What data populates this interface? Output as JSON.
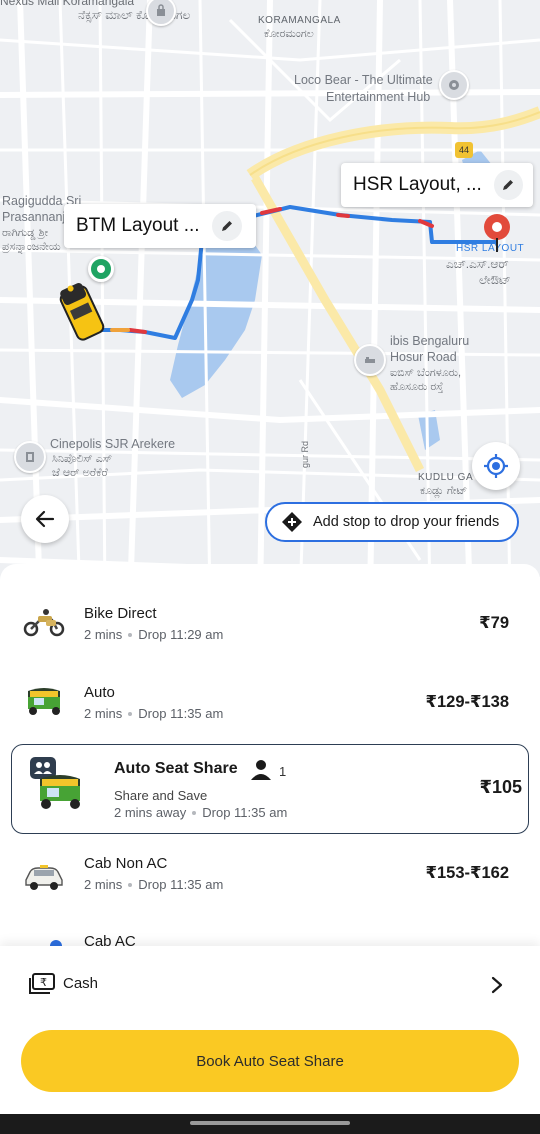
{
  "map": {
    "labels": {
      "nexus_mall": "Nexus Mall Koramangala",
      "nexus_mall_kn": "ನೆಕ್ಸಸ್ ಮಾಲ್ ಕೋರಮಂಗಲ",
      "koramangala": "KORAMANGALA",
      "koramangala_kn": "ಕೋರಮಂಗಲ",
      "loco_bear_1": "Loco Bear - The Ultimate",
      "loco_bear_2": "Entertainment Hub",
      "ragigudda_1": "Ragigudda Sri",
      "ragigudda_2": "Prasannanj",
      "ragigudda_3": "ರಾಗಿಗುಡ್ಡ ಶ್ರೀ",
      "ragigudda_4": "ಪ್ರಸನ್ನಾಂಜನೇಯ",
      "hsr_label": "HSR LAYOUT",
      "hsr_label_kn_1": "ಎಚ್.ಎಸ್.ಆರ್",
      "hsr_label_kn_2": "ಲೇಔಟ್",
      "ibis_1": "ibis Bengaluru",
      "ibis_2": "Hosur Road",
      "ibis_3": "ಐಬಿಸ್ ಬೆಂಗಳೂರು,",
      "ibis_4": "ಹೊಸೂರು ರಸ್ತೆ",
      "cinepolis_1": "Cinepolis SJR Arekere",
      "cinepolis_2": "ಸಿನಿಪೊಲಿಸ್ ಎಸ್",
      "cinepolis_3": "ಜೆ ಆರ್ ಅರೆಕೆರೆ",
      "kudlu_1": "KUDLU GA",
      "kudlu_2": "ಕೂಡ್ಲು ಗೇಟ್",
      "road_name": "gur Rd",
      "highway": "44"
    },
    "pickup_callout": "BTM Layout ...",
    "drop_callout": "HSR Layout, ...",
    "add_stop_label": "Add stop to drop your friends",
    "colors": {
      "route": "#2f7de1",
      "traffic": "#e0383e",
      "accent_blue": "#2d6fe0",
      "pickup_pin": "#1fa463",
      "drop_pin": "#e24a3b"
    }
  },
  "rides": [
    {
      "name": "Bike Direct",
      "eta": "2 mins",
      "drop": "Drop 11:29 am",
      "price": "₹79",
      "icon": "bike-icon"
    },
    {
      "name": "Auto",
      "eta": "2 mins",
      "drop": "Drop 11:35 am",
      "price": "₹129-₹138",
      "icon": "auto-rickshaw-icon"
    },
    {
      "name": "Auto Seat Share",
      "subtitle": "Share and Save",
      "eta": "2 mins away",
      "drop": "Drop 11:35 am",
      "price": "₹105",
      "seats": "1",
      "icon": "auto-share-icon",
      "selected": true
    },
    {
      "name": "Cab Non AC",
      "eta": "2 mins",
      "drop": "Drop 11:35 am",
      "price": "₹153-₹162",
      "icon": "cab-icon"
    },
    {
      "name": "Cab AC",
      "icon": "cab-ac-icon"
    }
  ],
  "payment": {
    "method": "Cash"
  },
  "cta": {
    "label": "Book Auto Seat Share",
    "color": "#fac923"
  }
}
